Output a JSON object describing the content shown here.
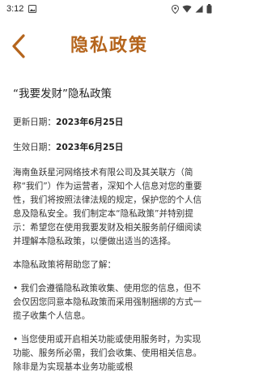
{
  "status": {
    "time": "3:12"
  },
  "header": {
    "title": "隐私政策"
  },
  "doc": {
    "title": "“我要发财”隐私政策",
    "update_label": "更新日期：",
    "update_date": "2023年6月25日",
    "effective_label": "生效日期：",
    "effective_date": "2023年6月25日",
    "intro": "海南鱼跃星河网络技术有限公司及其关联方（简称“我们”）作为运营者，深知个人信息对您的重要性，我们将按照法律法规的规定，保护您的个人信息及隐私安全。我们制定本“隐私政策”并特别提示：希望您在使用我要发财及相关服务前仔细阅读并理解本隐私政策，以便做出适当的选择。",
    "help_heading": "本隐私政策将帮助您了解：",
    "bullet1": "• 我们会遵循隐私政策收集、使用您的信息，但不会仅因您同意本隐私政策而采用强制捆绑的方式一揽子收集个人信息。",
    "bullet2": "• 当您使用或开启相关功能或使用服务时，为实现功能、服务所必需，我们会收集、使用相关信息。除非是为实现基本业务功能或根"
  },
  "colors": {
    "accent": "#b5651d"
  },
  "icons": [
    "gallery-icon",
    "location-icon",
    "wifi-icon",
    "signal-icon",
    "battery-icon",
    "back-chevron-icon"
  ]
}
